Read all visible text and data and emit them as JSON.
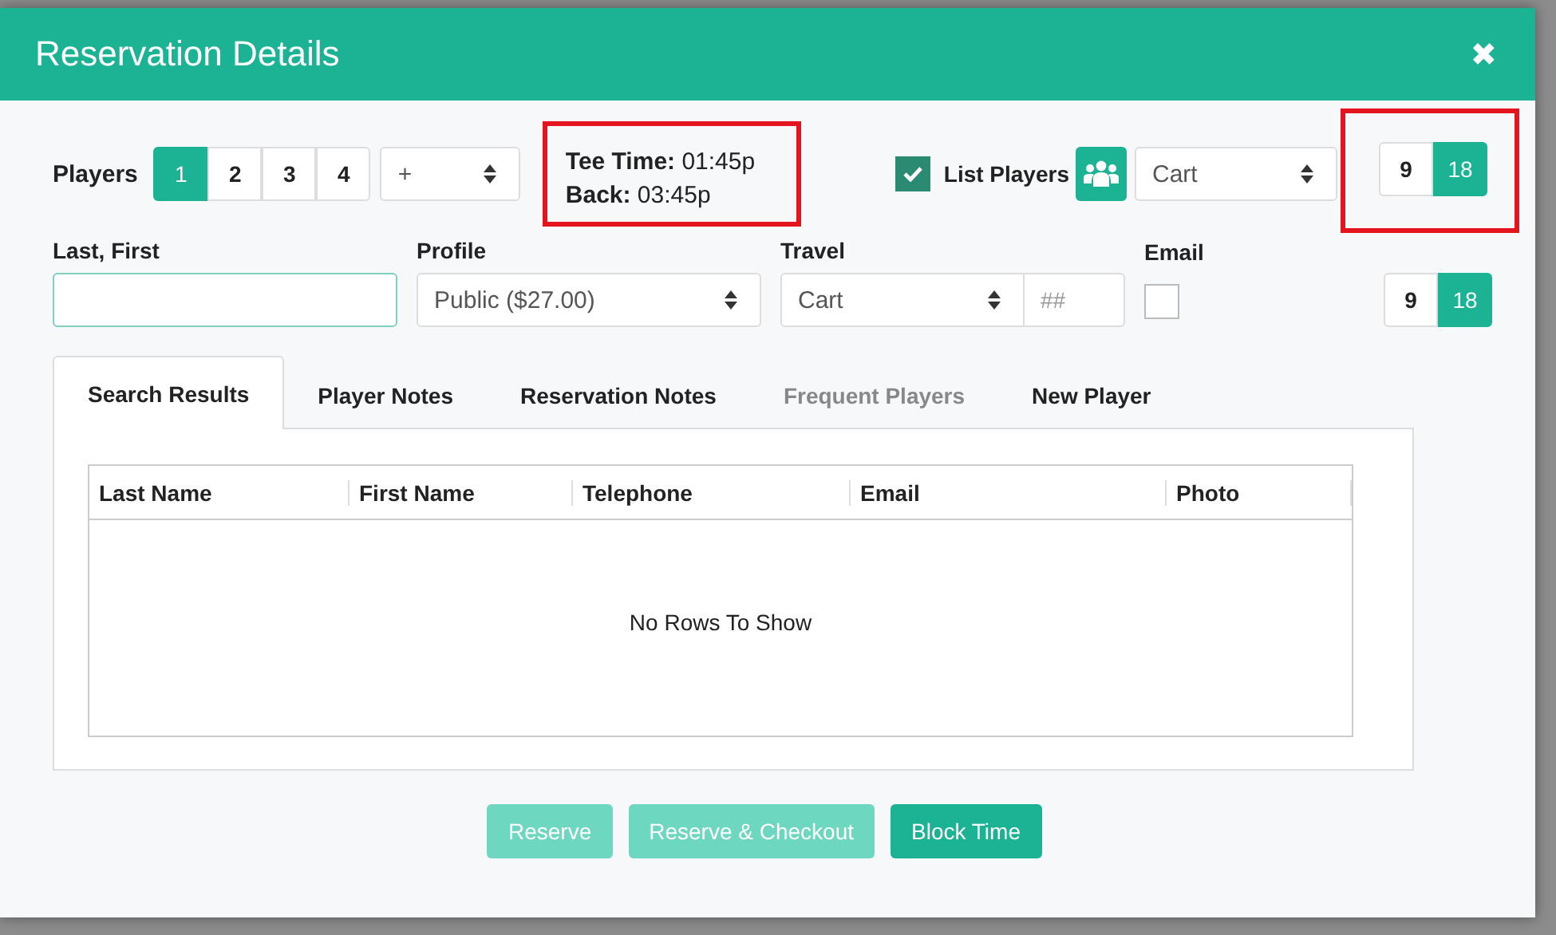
{
  "modal": {
    "title": "Reservation Details",
    "close": "✖"
  },
  "players": {
    "label": "Players",
    "options": [
      {
        "label": "1",
        "selected": true
      },
      {
        "label": "2",
        "selected": false
      },
      {
        "label": "3",
        "selected": false
      },
      {
        "label": "4",
        "selected": false
      }
    ],
    "extra": "+"
  },
  "tee_time": {
    "highlighted": true,
    "lines": [
      {
        "label": "Tee Time:",
        "value": "01:45p"
      },
      {
        "label": "Back:",
        "value": "03:45p"
      }
    ]
  },
  "list_players": {
    "checked": true,
    "label": "List Players",
    "travel": "Cart"
  },
  "holes_top": {
    "highlighted": true,
    "options": [
      {
        "label": "9",
        "selected": false
      },
      {
        "label": "18",
        "selected": true
      }
    ]
  },
  "name_field": {
    "label": "Last, First"
  },
  "profile": {
    "label": "Profile",
    "value": "Public ($27.00)"
  },
  "travel": {
    "label": "Travel",
    "value": "Cart",
    "count_placeholder": "##"
  },
  "email": {
    "label": "Email",
    "checked": false
  },
  "holes_bottom": {
    "options": [
      {
        "label": "9",
        "selected": false
      },
      {
        "label": "18",
        "selected": true
      }
    ]
  },
  "tabs": [
    {
      "label": "Search Results",
      "selected": true,
      "disabled": false
    },
    {
      "label": "Player Notes",
      "selected": false,
      "disabled": false
    },
    {
      "label": "Reservation Notes",
      "selected": false,
      "disabled": false
    },
    {
      "label": "Frequent Players",
      "selected": false,
      "disabled": true
    },
    {
      "label": "New Player",
      "selected": false,
      "disabled": false
    }
  ],
  "table": {
    "columns": [
      "Last Name",
      "First Name",
      "Telephone",
      "Email",
      "Photo"
    ],
    "empty_message": "No Rows To Show"
  },
  "buttons": [
    {
      "label": "Reserve",
      "disabled": true
    },
    {
      "label": "Reserve & Checkout",
      "disabled": true
    },
    {
      "label": "Block Time",
      "disabled": false
    }
  ]
}
